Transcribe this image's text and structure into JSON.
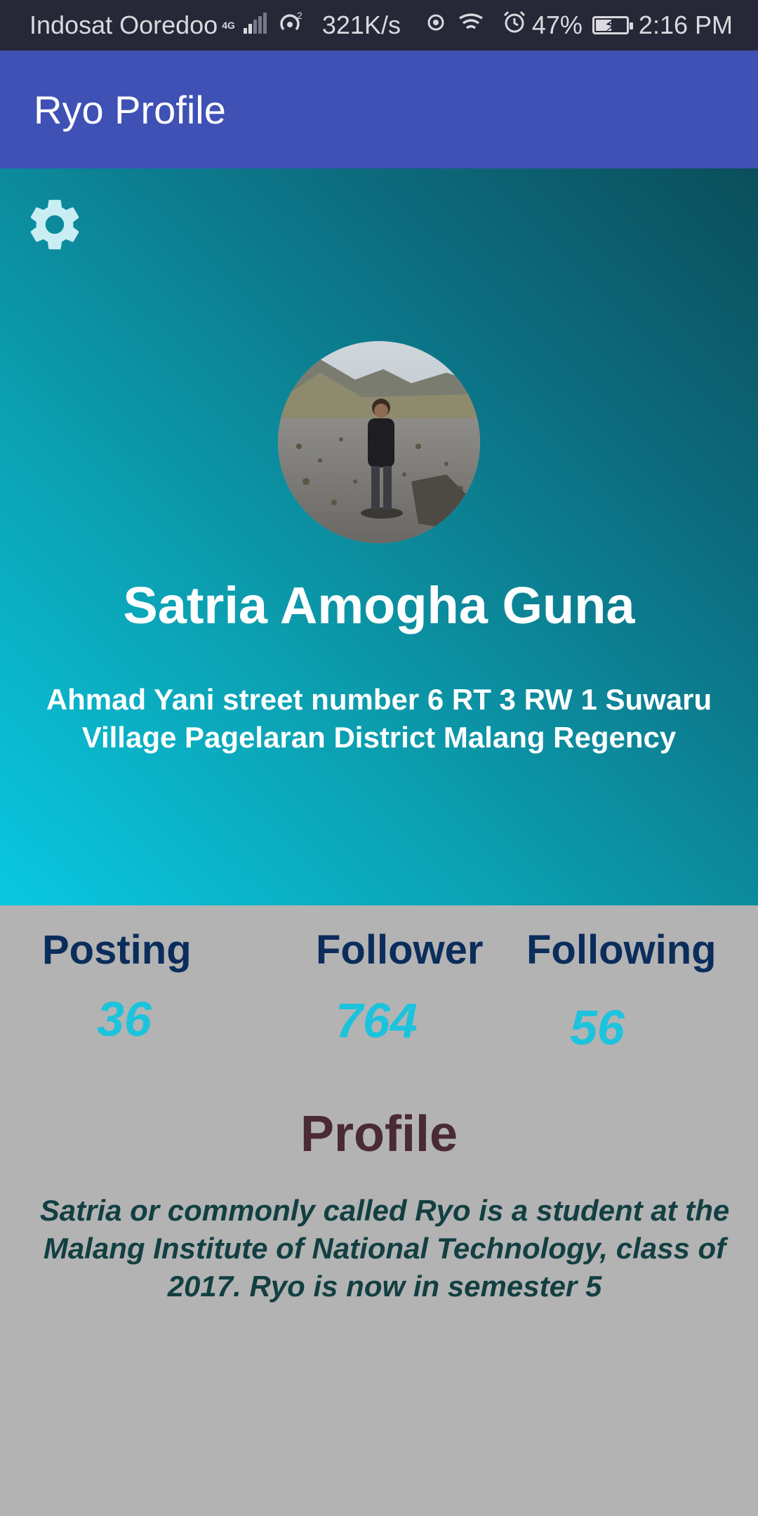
{
  "status_bar": {
    "carrier": "Indosat Ooredoo",
    "network_type": "4G",
    "hotspot_count": "2",
    "speed": "321K/s",
    "battery": "47%",
    "battery_level": 0.47,
    "time": "2:16 PM"
  },
  "app_bar": {
    "title": "Ryo Profile"
  },
  "header": {
    "settings_icon": "gear-icon",
    "name": "Satria Amogha Guna",
    "address": "Ahmad Yani street number 6 RT 3 RW 1 Suwaru Village Pagelaran District Malang Regency"
  },
  "stats": {
    "posting_label": "Posting",
    "posting_value": "36",
    "follower_label": "Follower",
    "follower_value": "764",
    "following_label": "Following",
    "following_value": "56"
  },
  "profile": {
    "title": "Profile",
    "bio": "Satria or commonly called Ryo is a student at the Malang Institute of National Technology, class of 2017. Ryo is now in semester 5"
  },
  "colors": {
    "app_bar": "#3f51b5",
    "status_bar": "#262838",
    "stat_label": "#0b2d5c",
    "stat_value": "#1cc3dd",
    "profile_title": "#4a2a33",
    "bio": "#123f42",
    "background": "#b3b3b3"
  }
}
